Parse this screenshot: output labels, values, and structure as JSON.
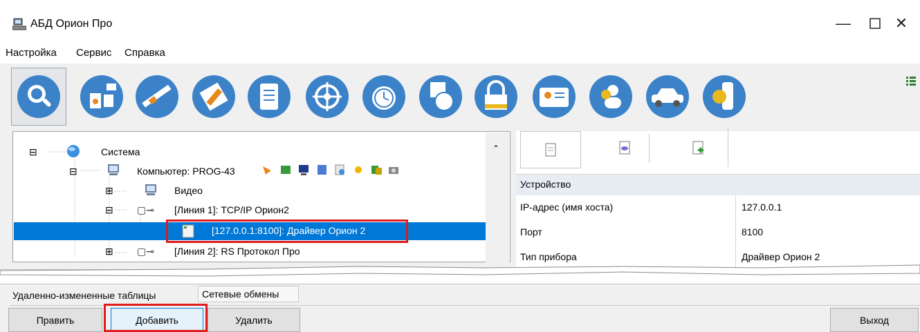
{
  "window": {
    "title": "АБД Орион Про",
    "controls": [
      "minimize-icon",
      "maximize-icon",
      "close-icon"
    ]
  },
  "menu": [
    "Настройка",
    "Сервис",
    "Справка"
  ],
  "toolbar": {
    "icons": [
      "search-icon",
      "devices-icon",
      "barrier-icon",
      "plan-edit-icon",
      "document-icon",
      "wheel-icon",
      "alarm-clock-icon",
      "schedule-clock-icon",
      "lock-icon",
      "id-card-icon",
      "employees-icon",
      "car-icon",
      "key-icon"
    ],
    "active_index": 0
  },
  "tree": {
    "items": [
      {
        "label": "Система",
        "icon": "globe-icon",
        "expander": "⊟"
      },
      {
        "label": "Компьютер: PROG-43",
        "icon": "computer-icon",
        "expander": "⊟"
      },
      {
        "label": "Видео",
        "icon": "computer-icon",
        "expander": "⊞"
      },
      {
        "label": "[Линия 1]: TCP/IP  Орион2",
        "icon": "line-icon",
        "expander": "⊟"
      },
      {
        "label": "[127.0.0.1:8100]: Драйвер Орион 2",
        "icon": "driver-icon",
        "selected": true
      },
      {
        "label": "[Линия 2]: RS  Протокол Про",
        "icon": "line-icon",
        "expander": "⊞"
      }
    ]
  },
  "properties": {
    "tabs": [
      "document-icon",
      "chat-icon",
      "add-document-icon"
    ],
    "section": "Устройство",
    "rows": [
      {
        "key": "IP-адрес (имя хоста)",
        "value": "127.0.0.1"
      },
      {
        "key": "Порт",
        "value": "8100"
      },
      {
        "key": "Тип прибора",
        "value": "Драйвер Орион 2"
      }
    ]
  },
  "bottom_tabs": [
    "Удаленно-измененные таблицы",
    "Сетевые обмены"
  ],
  "buttons": {
    "edit": "Править",
    "add": "Добавить",
    "delete": "Удалить",
    "exit": "Выход"
  },
  "colors": {
    "selection": "#0078d7",
    "highlight_box": "#e01b1b",
    "section_header": "#e8edf3"
  }
}
